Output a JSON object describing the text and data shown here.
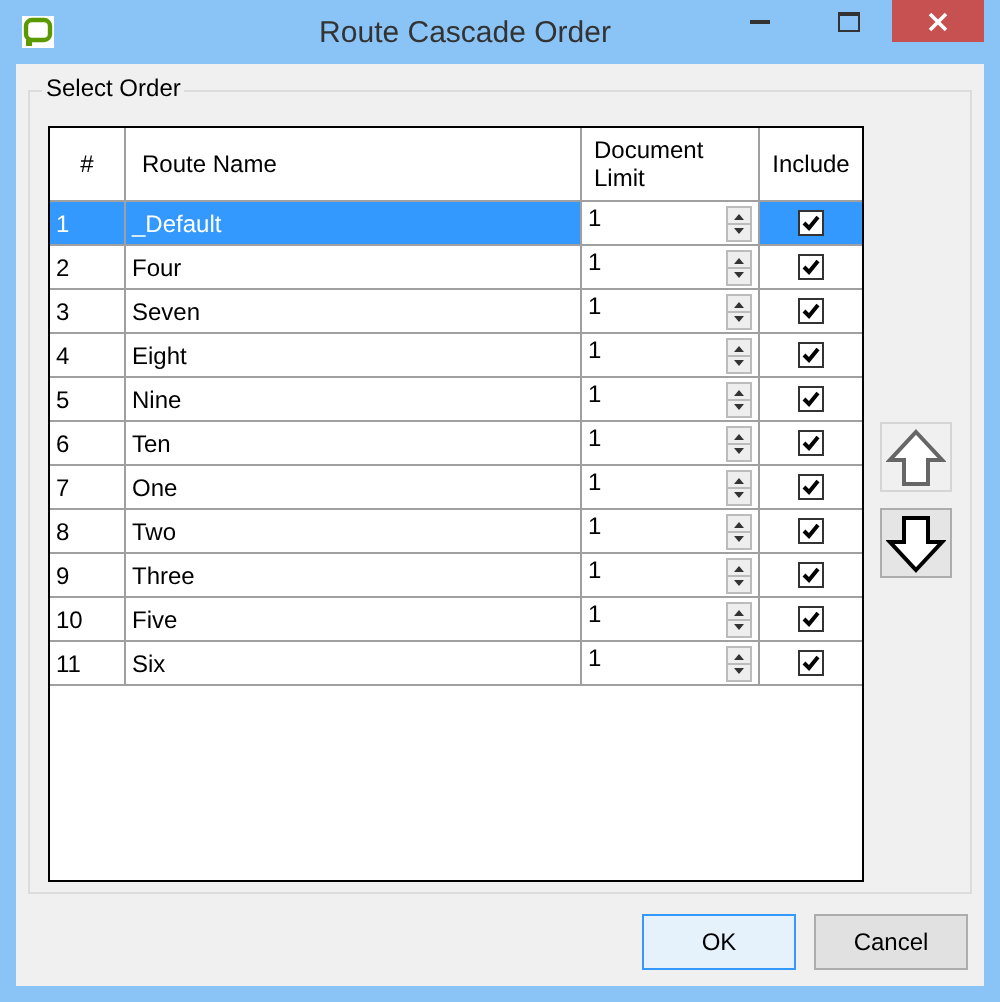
{
  "window": {
    "title": "Route Cascade Order"
  },
  "group": {
    "label": "Select Order"
  },
  "table": {
    "columns": [
      "#",
      "Route Name",
      "Document Limit",
      "Include"
    ],
    "rows": [
      {
        "index": "1",
        "name": "_Default",
        "limit": "1",
        "include": true,
        "selected": true
      },
      {
        "index": "2",
        "name": "Four",
        "limit": "1",
        "include": true,
        "selected": false
      },
      {
        "index": "3",
        "name": "Seven",
        "limit": "1",
        "include": true,
        "selected": false
      },
      {
        "index": "4",
        "name": "Eight",
        "limit": "1",
        "include": true,
        "selected": false
      },
      {
        "index": "5",
        "name": "Nine",
        "limit": "1",
        "include": true,
        "selected": false
      },
      {
        "index": "6",
        "name": "Ten",
        "limit": "1",
        "include": true,
        "selected": false
      },
      {
        "index": "7",
        "name": "One",
        "limit": "1",
        "include": true,
        "selected": false
      },
      {
        "index": "8",
        "name": "Two",
        "limit": "1",
        "include": true,
        "selected": false
      },
      {
        "index": "9",
        "name": "Three",
        "limit": "1",
        "include": true,
        "selected": false
      },
      {
        "index": "10",
        "name": "Five",
        "limit": "1",
        "include": true,
        "selected": false
      },
      {
        "index": "11",
        "name": "Six",
        "limit": "1",
        "include": true,
        "selected": false
      }
    ]
  },
  "move_up": {
    "disabled": true
  },
  "move_down": {
    "disabled": false
  },
  "buttons": [
    {
      "label": "OK",
      "default": true
    },
    {
      "label": "Cancel",
      "default": false
    }
  ]
}
